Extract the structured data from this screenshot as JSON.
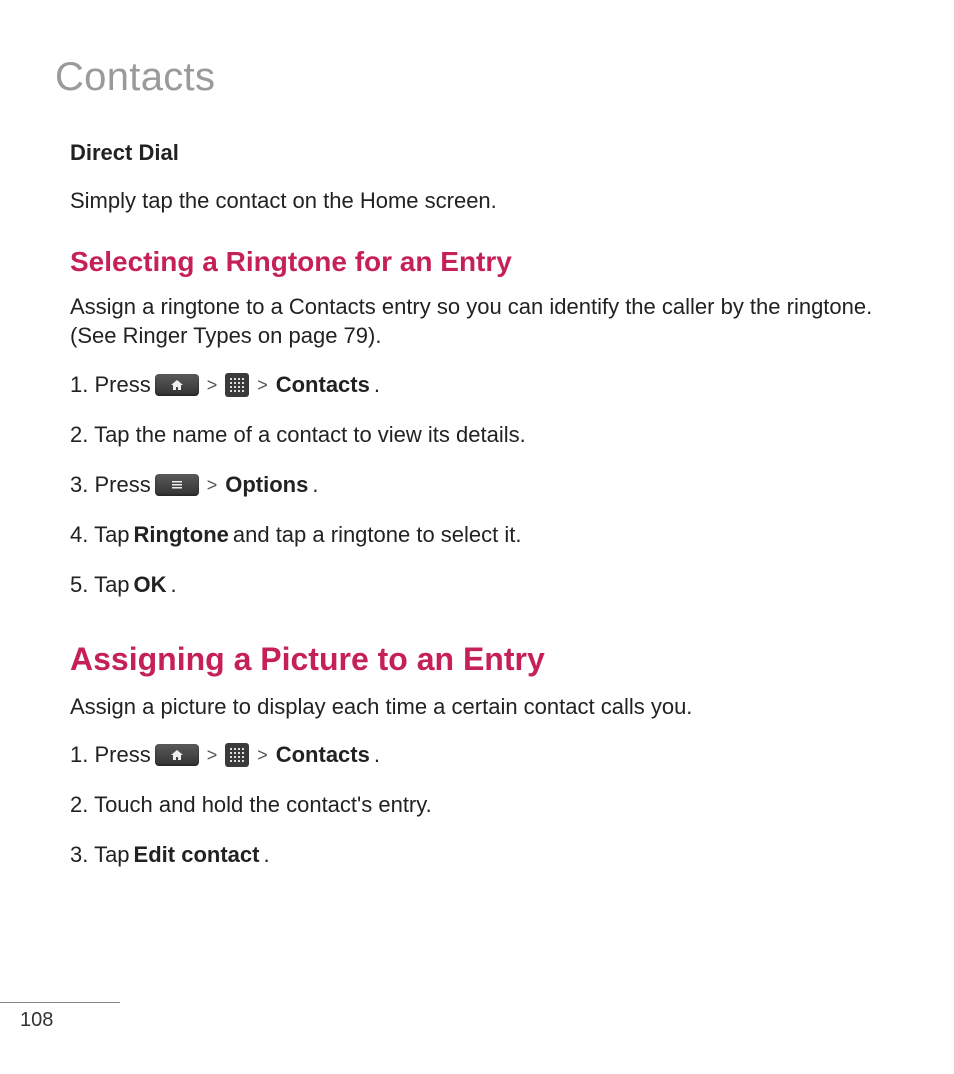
{
  "pageTitle": "Contacts",
  "directDial": {
    "heading": "Direct Dial",
    "body": "Simply tap the contact on the Home screen."
  },
  "ringtone": {
    "heading": "Selecting a Ringtone for an Entry",
    "intro": "Assign a ringtone to a Contacts entry so you can identify the caller by the ringtone. (See Ringer Types on page 79).",
    "step1_a": "1.  Press",
    "step1_b": "Contacts",
    "step1_c": ".",
    "step2": "2.  Tap the name of a contact to view its details.",
    "step3_a": "3. Press",
    "step3_b": "Options",
    "step3_c": ".",
    "step4_a": "4. Tap ",
    "step4_b": "Ringtone",
    "step4_c": " and tap a ringtone to select it.",
    "step5_a": "5. Tap ",
    "step5_b": "OK",
    "step5_c": "."
  },
  "picture": {
    "heading": "Assigning a Picture to an Entry",
    "intro": "Assign a picture to display each time a certain contact calls you.",
    "step1_a": "1. Press",
    "step1_b": "Contacts",
    "step1_c": ".",
    "step2": "2. Touch and hold the contact's entry.",
    "step3_a": "3. Tap ",
    "step3_b": "Edit contact",
    "step3_c": "."
  },
  "chev": ">",
  "pageNumber": "108"
}
